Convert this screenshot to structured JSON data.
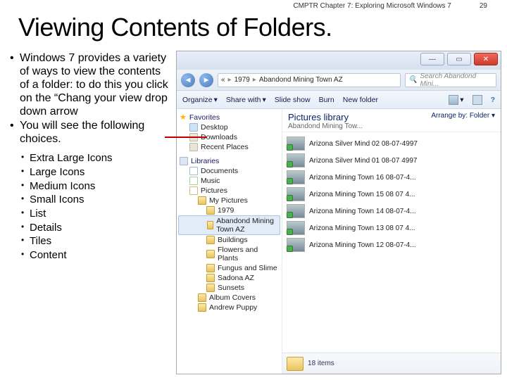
{
  "header": {
    "chapter": "CMPTR Chapter 7: Exploring Microsoft Windows 7",
    "page": "29"
  },
  "title": "Viewing Contents of Folders.",
  "bullets": {
    "main": [
      "Windows 7 provides a variety of ways to view the contents of a folder: to do this you click on the “Chang your view drop down arrow",
      "You will see the following choices."
    ],
    "sub": [
      "Extra Large Icons",
      "Large Icons",
      "Medium Icons",
      "Small Icons",
      "List",
      "Details",
      "Tiles",
      "Content"
    ]
  },
  "explorer": {
    "breadcrumb": [
      "«",
      "1979",
      "Abandond Mining Town AZ"
    ],
    "search_placeholder": "Search Abandond Mini...",
    "toolbar": [
      "Organize",
      "Share with",
      "Slide show",
      "Burn",
      "New folder"
    ],
    "library_title": "Pictures library",
    "library_subtitle": "Abandond Mining Tow...",
    "arrange_label": "Arrange by:",
    "arrange_value": "Folder",
    "nav": {
      "favorites": {
        "label": "Favorites",
        "items": [
          "Desktop",
          "Downloads",
          "Recent Places"
        ]
      },
      "libraries": {
        "label": "Libraries",
        "items": [
          "Documents",
          "Music",
          "Pictures",
          "My Pictures",
          "1979",
          "Abandond Mining Town AZ",
          "Buildings",
          "Flowers and Plants",
          "Fungus and Slime",
          "Sadona AZ",
          "Sunsets",
          "Album Covers",
          "Andrew Puppy"
        ]
      }
    },
    "files": [
      "Arizona Silver Mind 02 08-07-4997",
      "Arizona Silver Mind 01 08-07 4997",
      "Arizona Mining Town 16 08-07-4...",
      "Arizona Mining Town 15 08 07 4...",
      "Arizona Mining Town 14 08-07-4...",
      "Arizona Mining Town 13 08 07 4...",
      "Arizona Mining Town 12 08-07-4..."
    ],
    "status": "18 items"
  }
}
